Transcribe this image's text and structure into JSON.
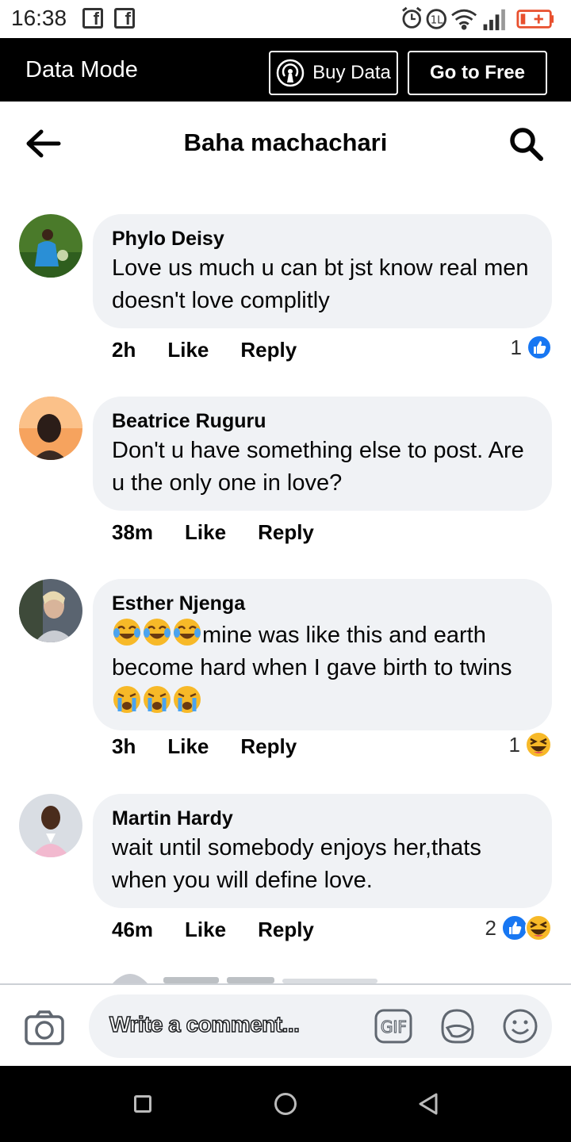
{
  "status_bar": {
    "time": "16:38",
    "icons": [
      "facebook-icon",
      "facebook-icon",
      "alarm-icon",
      "data-saver-icon",
      "wifi-icon",
      "signal-icon",
      "battery-icon"
    ]
  },
  "data_mode": {
    "title": "Data Mode",
    "buy_data_label": "Buy Data",
    "go_free_label": "Go to Free"
  },
  "header": {
    "title": "Baha machachari"
  },
  "comments": [
    {
      "author": "Phylo Deisy",
      "text": "Love us much u can bt jst know real men doesn't love complitly",
      "age": "2h",
      "like_label": "Like",
      "reply_label": "Reply",
      "reaction_count": "1",
      "reactions": [
        "like"
      ]
    },
    {
      "author": "Beatrice Ruguru",
      "text": "Don't u have something else to post. Are u the only one in love?",
      "age": "38m",
      "like_label": "Like",
      "reply_label": "Reply"
    },
    {
      "author": "Esther Njenga",
      "text_after_emoji": "mine was like this and earth become hard when I gave birth to twins",
      "age": "3h",
      "like_label": "Like",
      "reply_label": "Reply",
      "reaction_count": "1",
      "reactions": [
        "haha"
      ]
    },
    {
      "author": "Martin Hardy",
      "text": "wait until somebody enjoys her,thats when you will define love.",
      "age": "46m",
      "like_label": "Like",
      "reply_label": "Reply",
      "reaction_count": "2",
      "reactions": [
        "like",
        "haha"
      ]
    }
  ],
  "composer": {
    "placeholder": "Write a comment...",
    "gif_label": "GIF"
  },
  "colors": {
    "bubble": "#f0f2f5",
    "like_blue": "#1877f2",
    "haha_yellow": "#f7b928",
    "data_bar": "#000000"
  }
}
